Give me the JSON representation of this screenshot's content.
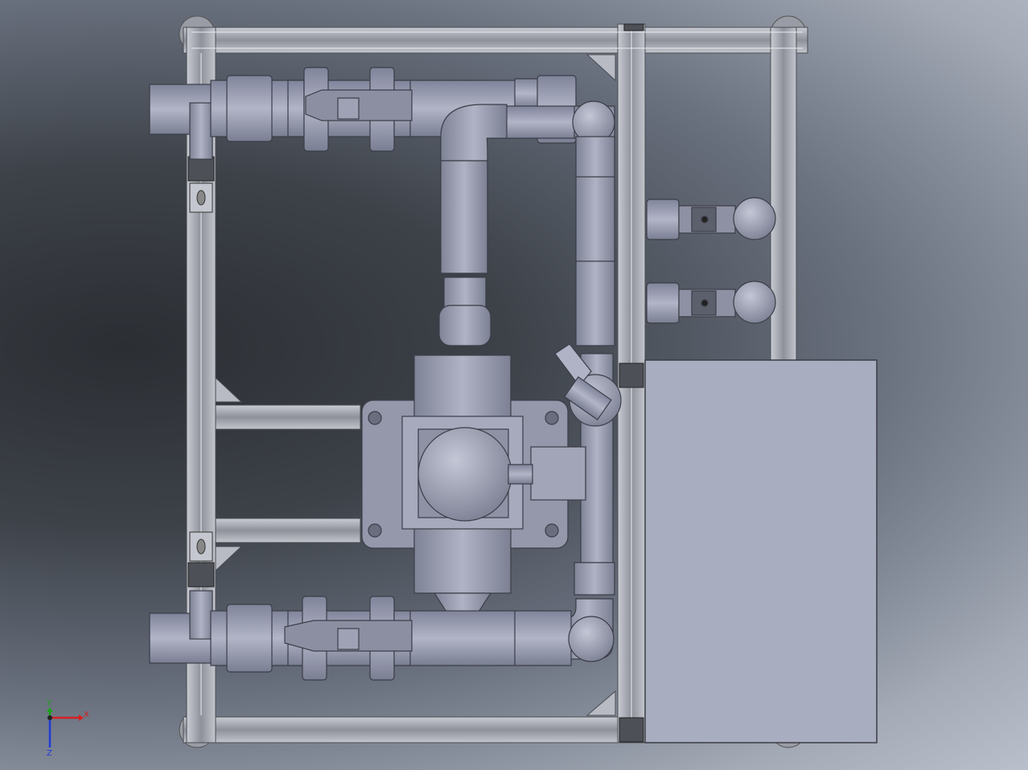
{
  "viewport": {
    "background_dark": "#2b2e33",
    "background_light": "#b9bfcb"
  },
  "model": {
    "frame_color": "#a8abb3",
    "pipe_color": "#9a9db0",
    "panel_color": "#a9adc0"
  },
  "triad": {
    "x_label": "X",
    "y_label": "Y",
    "z_label": "Z",
    "x_color": "#d62020",
    "y_color": "#1aa41a",
    "z_color": "#1f3bd6"
  }
}
